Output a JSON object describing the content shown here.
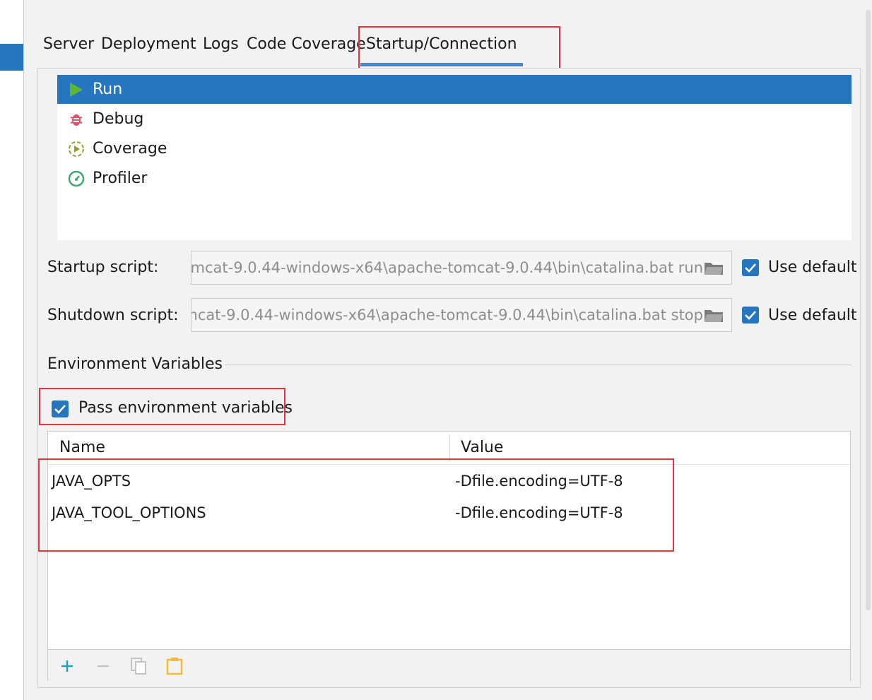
{
  "tabs": [
    {
      "label": "Server"
    },
    {
      "label": "Deployment"
    },
    {
      "label": "Logs"
    },
    {
      "label": "Code Coverage"
    },
    {
      "label": "Startup/Connection",
      "active": true
    }
  ],
  "executors": [
    {
      "label": "Run",
      "icon": "run-icon",
      "selected": true
    },
    {
      "label": "Debug",
      "icon": "debug-icon"
    },
    {
      "label": "Coverage",
      "icon": "coverage-icon"
    },
    {
      "label": "Profiler",
      "icon": "profiler-icon"
    }
  ],
  "startup": {
    "label": "Startup script:",
    "value": "...\\apache-tomcat-9.0.44-windows-x64\\apache-tomcat-9.0.44\\bin\\catalina.bat run",
    "use_default_label": "Use default",
    "use_default_checked": true
  },
  "shutdown": {
    "label": "Shutdown script:",
    "value": "...\\apache-tomcat-9.0.44-windows-x64\\apache-tomcat-9.0.44\\bin\\catalina.bat stop",
    "use_default_label": "Use default",
    "use_default_checked": true
  },
  "env": {
    "section_title": "Environment Variables",
    "pass_label": "Pass environment variables",
    "pass_checked": true,
    "columns": [
      "Name",
      "Value"
    ],
    "rows": [
      {
        "name": "JAVA_OPTS",
        "value": "-Dfile.encoding=UTF-8"
      },
      {
        "name": "JAVA_TOOL_OPTIONS",
        "value": "-Dfile.encoding=UTF-8"
      }
    ]
  },
  "toolbar": [
    "add-icon",
    "remove-icon",
    "copy-icon",
    "paste-icon"
  ],
  "colors": {
    "accent": "#2675bf",
    "highlight": "#e8353b",
    "run_green": "#5fb832",
    "debug_red": "#e0536a",
    "coverage_olive": "#9a9b2d",
    "profiler_green": "#41a870",
    "paste_orange": "#f5b93a",
    "add_teal": "#1ba6c2"
  }
}
